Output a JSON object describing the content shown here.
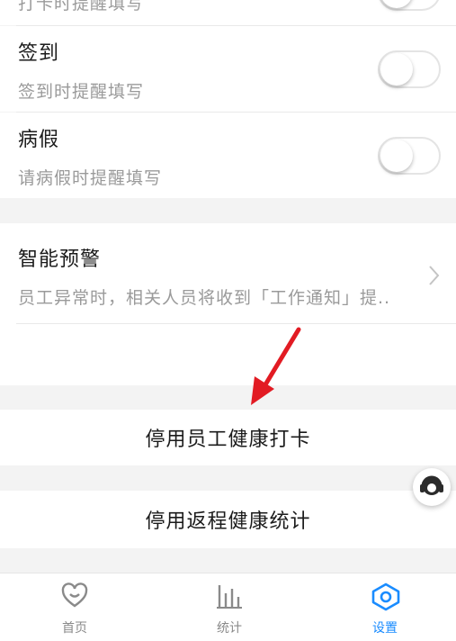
{
  "settings": {
    "clock_in_subtitle": "打卡时提醒填写",
    "sign_in": {
      "title": "签到",
      "subtitle": "签到时提醒填写",
      "enabled": false
    },
    "sick_leave": {
      "title": "病假",
      "subtitle": "请病假时提醒填写",
      "enabled": false
    }
  },
  "warning": {
    "title": "智能预警",
    "subtitle": "员工异常时，相关人员将收到「工作通知」提.."
  },
  "actions": {
    "disable_health_clockin": "停用员工健康打卡",
    "disable_return_stats": "停用返程健康统计"
  },
  "tabbar": {
    "tabs": [
      {
        "label": "首页",
        "icon": "heart-icon"
      },
      {
        "label": "统计",
        "icon": "bar-chart-icon"
      },
      {
        "label": "设置",
        "icon": "gear-icon",
        "active": true
      }
    ]
  },
  "colors": {
    "accent": "#1a8cff",
    "annotation_arrow": "#e21b23"
  }
}
